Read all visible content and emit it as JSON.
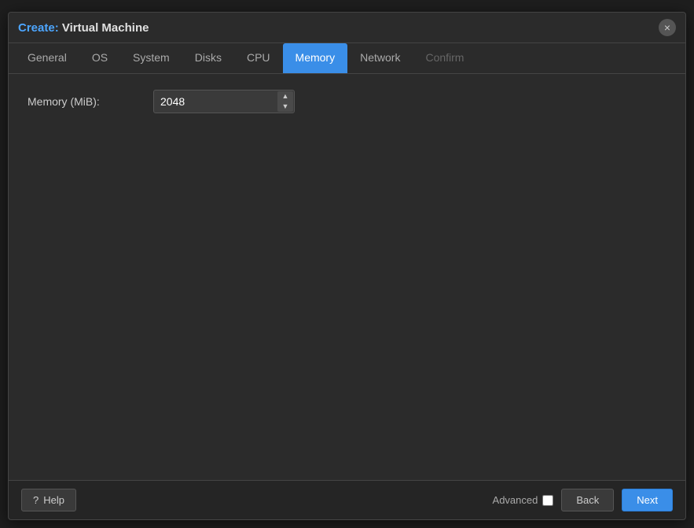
{
  "dialog": {
    "title_prefix": "Create:",
    "title_suffix": " Virtual Machine",
    "close_label": "×"
  },
  "tabs": [
    {
      "id": "general",
      "label": "General",
      "active": false,
      "disabled": false
    },
    {
      "id": "os",
      "label": "OS",
      "active": false,
      "disabled": false
    },
    {
      "id": "system",
      "label": "System",
      "active": false,
      "disabled": false
    },
    {
      "id": "disks",
      "label": "Disks",
      "active": false,
      "disabled": false
    },
    {
      "id": "cpu",
      "label": "CPU",
      "active": false,
      "disabled": false
    },
    {
      "id": "memory",
      "label": "Memory",
      "active": true,
      "disabled": false
    },
    {
      "id": "network",
      "label": "Network",
      "active": false,
      "disabled": false
    },
    {
      "id": "confirm",
      "label": "Confirm",
      "active": false,
      "disabled": true
    }
  ],
  "form": {
    "memory_label": "Memory (MiB):",
    "memory_value": "2048"
  },
  "footer": {
    "help_label": "Help",
    "advanced_label": "Advanced",
    "back_label": "Back",
    "next_label": "Next"
  }
}
